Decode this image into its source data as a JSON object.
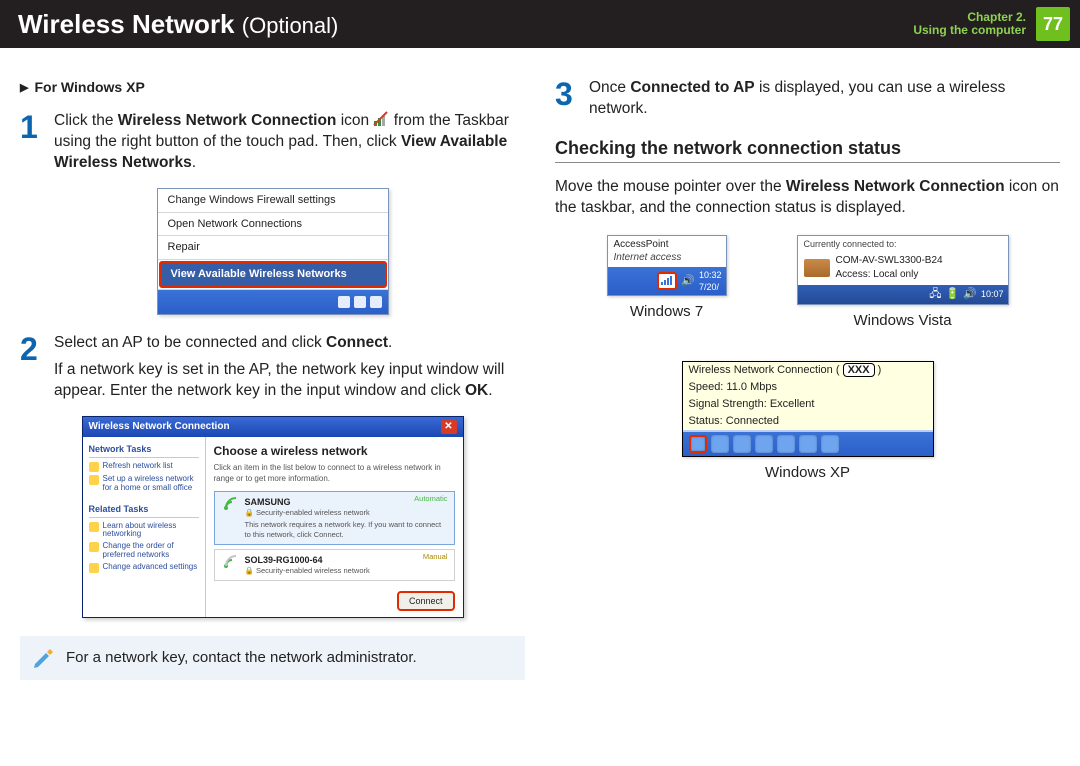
{
  "header": {
    "title_main": "Wireless Network",
    "title_opt": "(Optional)",
    "chapter_line1": "Chapter 2.",
    "chapter_line2": "Using the computer",
    "page_number": "77"
  },
  "left": {
    "sub_heading": "For Windows XP",
    "step1_num": "1",
    "step1_a": "Click the ",
    "step1_b": "Wireless Network Connection",
    "step1_c": " icon ",
    "step1_d": " from the Taskbar using the right button of the touch pad. Then, click ",
    "step1_e": "View Available Wireless Networks",
    "step1_f": ".",
    "fig1": {
      "menu1": "Change Windows Firewall settings",
      "menu2": "Open Network Connections",
      "menu3": "Repair",
      "menu_highlight": "View Available Wireless Networks"
    },
    "step2_num": "2",
    "step2_a": "Select an AP to be connected and click ",
    "step2_b": "Connect",
    "step2_c": ".",
    "step2_para2a": "If a network key is set in the AP, the network key input window will appear. Enter the network key in the input window and click ",
    "step2_para2b": "OK",
    "step2_para2c": ".",
    "fig2": {
      "titlebar": "Wireless Network Connection",
      "side_title1": "Network Tasks",
      "side_link1": "Refresh network list",
      "side_link2": "Set up a wireless network for a home or small office",
      "side_title2": "Related Tasks",
      "side_link3": "Learn about wireless networking",
      "side_link4": "Change the order of preferred networks",
      "side_link5": "Change advanced settings",
      "choose_title": "Choose a wireless network",
      "choose_desc": "Click an item in the list below to connect to a wireless network in range or to get more information.",
      "net1_name": "SAMSUNG",
      "net1_sub": "Security-enabled wireless network",
      "net1_sub2": "This network requires a network key. If you want to connect to this network, click Connect.",
      "net1_tag": "Automatic",
      "net2_name": "SOL39-RG1000-64",
      "net2_sub": "Security-enabled wireless network",
      "net2_tag": "Manual",
      "connect_btn": "Connect"
    },
    "note_text": "For a network key, contact the network administrator."
  },
  "right": {
    "step3_num": "3",
    "step3_a": "Once ",
    "step3_b": "Connected to AP",
    "step3_c": " is displayed, you can use a wireless network.",
    "section_title": "Checking the network connection status",
    "para_a": "Move the mouse pointer over the ",
    "para_b": "Wireless Network Connection",
    "para_c": " icon on the taskbar, and the connection status is displayed.",
    "win7": {
      "line1": "AccessPoint",
      "line2": "Internet access",
      "time": "10:32",
      "date": "7/20/",
      "caption": "Windows 7"
    },
    "vista": {
      "hdr": "Currently connected to:",
      "name": "COM-AV-SWL3300-B24",
      "access": "Access:  Local only",
      "time": "10:07",
      "caption": "Windows Vista"
    },
    "xp": {
      "line1a": "Wireless Network Connection (",
      "line1b": "XXX",
      "line1c": ")",
      "line2": "Speed: 11.0 Mbps",
      "line3": "Signal Strength: Excellent",
      "line4": "Status:  Connected",
      "caption": "Windows XP"
    }
  }
}
